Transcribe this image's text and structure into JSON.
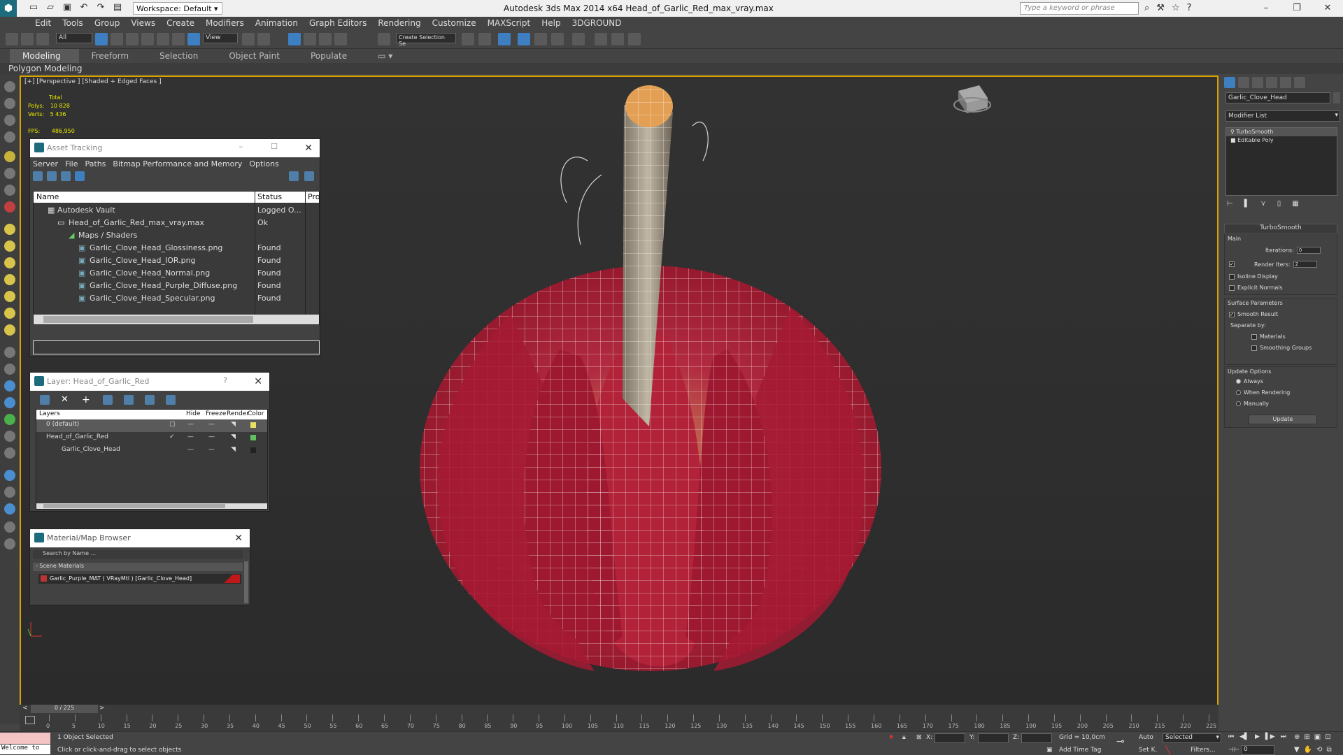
{
  "titlebar": {
    "workspace": "Workspace: Default",
    "title": "Autodesk 3ds Max  2014 x64     Head_of_Garlic_Red_max_vray.max",
    "search_placeholder": "Type a keyword or phrase"
  },
  "menu": [
    "Edit",
    "Tools",
    "Group",
    "Views",
    "Create",
    "Modifiers",
    "Animation",
    "Graph Editors",
    "Rendering",
    "Customize",
    "MAXScript",
    "Help",
    "3DGROUND"
  ],
  "toolbar": {
    "selection_filter": "All",
    "ref_coord": "View",
    "named_selection": "Create Selection Se"
  },
  "ribbon": {
    "tabs": [
      "Modeling",
      "Freeform",
      "Selection",
      "Object Paint",
      "Populate"
    ],
    "active": "Modeling",
    "sub": "Polygon Modeling"
  },
  "viewport": {
    "label": "[+] [Perspective ] [Shaded + Edged Faces ]",
    "stats_total": "Total",
    "polys_label": "Polys:",
    "polys": "10 828",
    "verts_label": "Verts:",
    "verts": "5 436",
    "fps_label": "FPS:",
    "fps": "486,950"
  },
  "asset_tracking": {
    "title": "Asset Tracking",
    "menu": [
      "Server",
      "File",
      "Paths",
      "Bitmap Performance and Memory",
      "Options"
    ],
    "columns": [
      "Name",
      "Status",
      "Pro"
    ],
    "rows": [
      {
        "name": "Autodesk Vault",
        "status": "Logged O..."
      },
      {
        "name": "Head_of_Garlic_Red_max_vray.max",
        "status": "Ok"
      },
      {
        "name": "Maps / Shaders",
        "status": ""
      },
      {
        "name": "Garlic_Clove_Head_Glossiness.png",
        "status": "Found"
      },
      {
        "name": "Garlic_Clove_Head_IOR.png",
        "status": "Found"
      },
      {
        "name": "Garlic_Clove_Head_Normal.png",
        "status": "Found"
      },
      {
        "name": "Garlic_Clove_Head_Purple_Diffuse.png",
        "status": "Found"
      },
      {
        "name": "Garlic_Clove_Head_Specular.png",
        "status": "Found"
      }
    ]
  },
  "layer": {
    "title": "Layer: Head_of_Garlic_Red",
    "columns": [
      "Layers",
      "Hide",
      "Freeze",
      "Render",
      "Color"
    ],
    "rows": [
      {
        "name": "0 (default)",
        "color": "#e8e060"
      },
      {
        "name": "Head_of_Garlic_Red",
        "color": "#60c060"
      },
      {
        "name": "Garlic_Clove_Head",
        "color": "#222222"
      }
    ]
  },
  "material_browser": {
    "title": "Material/Map Browser",
    "search_placeholder": "Search by Name ...",
    "section": "- Scene Materials",
    "item": "Garlic_Purple_MAT  ( VRayMtl ) [Garlic_Clove_Head]"
  },
  "command_panel": {
    "object_name": "Garlic_Clove_Head",
    "modifier_list": "Modifier List",
    "stack": [
      "TurboSmooth",
      "Editable Poly"
    ],
    "rollout_title": "TurboSmooth",
    "main": "Main",
    "iterations_label": "Iterations:",
    "iterations": "0",
    "render_iters_label": "Render Iters:",
    "render_iters": "2",
    "isoline": "Isoline Display",
    "explicit": "Explicit Normals",
    "surface_params": "Surface Parameters",
    "smooth_result": "Smooth Result",
    "separate_by": "Separate by:",
    "materials": "Materials",
    "smoothing_groups": "Smoothing Groups",
    "update_options": "Update Options",
    "always": "Always",
    "when_rendering": "When Rendering",
    "manually": "Manually",
    "update_btn": "Update"
  },
  "timeline": {
    "frame": "0 / 225",
    "ticks": [
      "0",
      "5",
      "10",
      "15",
      "20",
      "25",
      "30",
      "35",
      "40",
      "45",
      "50",
      "55",
      "60",
      "65",
      "70",
      "75",
      "80",
      "85",
      "90",
      "95",
      "100",
      "105",
      "110",
      "115",
      "120",
      "125",
      "130",
      "135",
      "140",
      "145",
      "150",
      "155",
      "160",
      "165",
      "170",
      "175",
      "180",
      "185",
      "190",
      "195",
      "200",
      "205",
      "210",
      "215",
      "220",
      "225"
    ]
  },
  "status": {
    "listener": "Welcome to",
    "selected": "1 Object Selected",
    "hint": "Click or click-and-drag to select objects",
    "x_label": "X:",
    "y_label": "Y:",
    "z_label": "Z:",
    "grid": "Grid = 10,0cm",
    "add_time_tag": "Add Time Tag",
    "auto": "Auto",
    "set_key": "Set K.",
    "key_mode": "Selected",
    "filters": "Filters...",
    "frame": "0"
  }
}
